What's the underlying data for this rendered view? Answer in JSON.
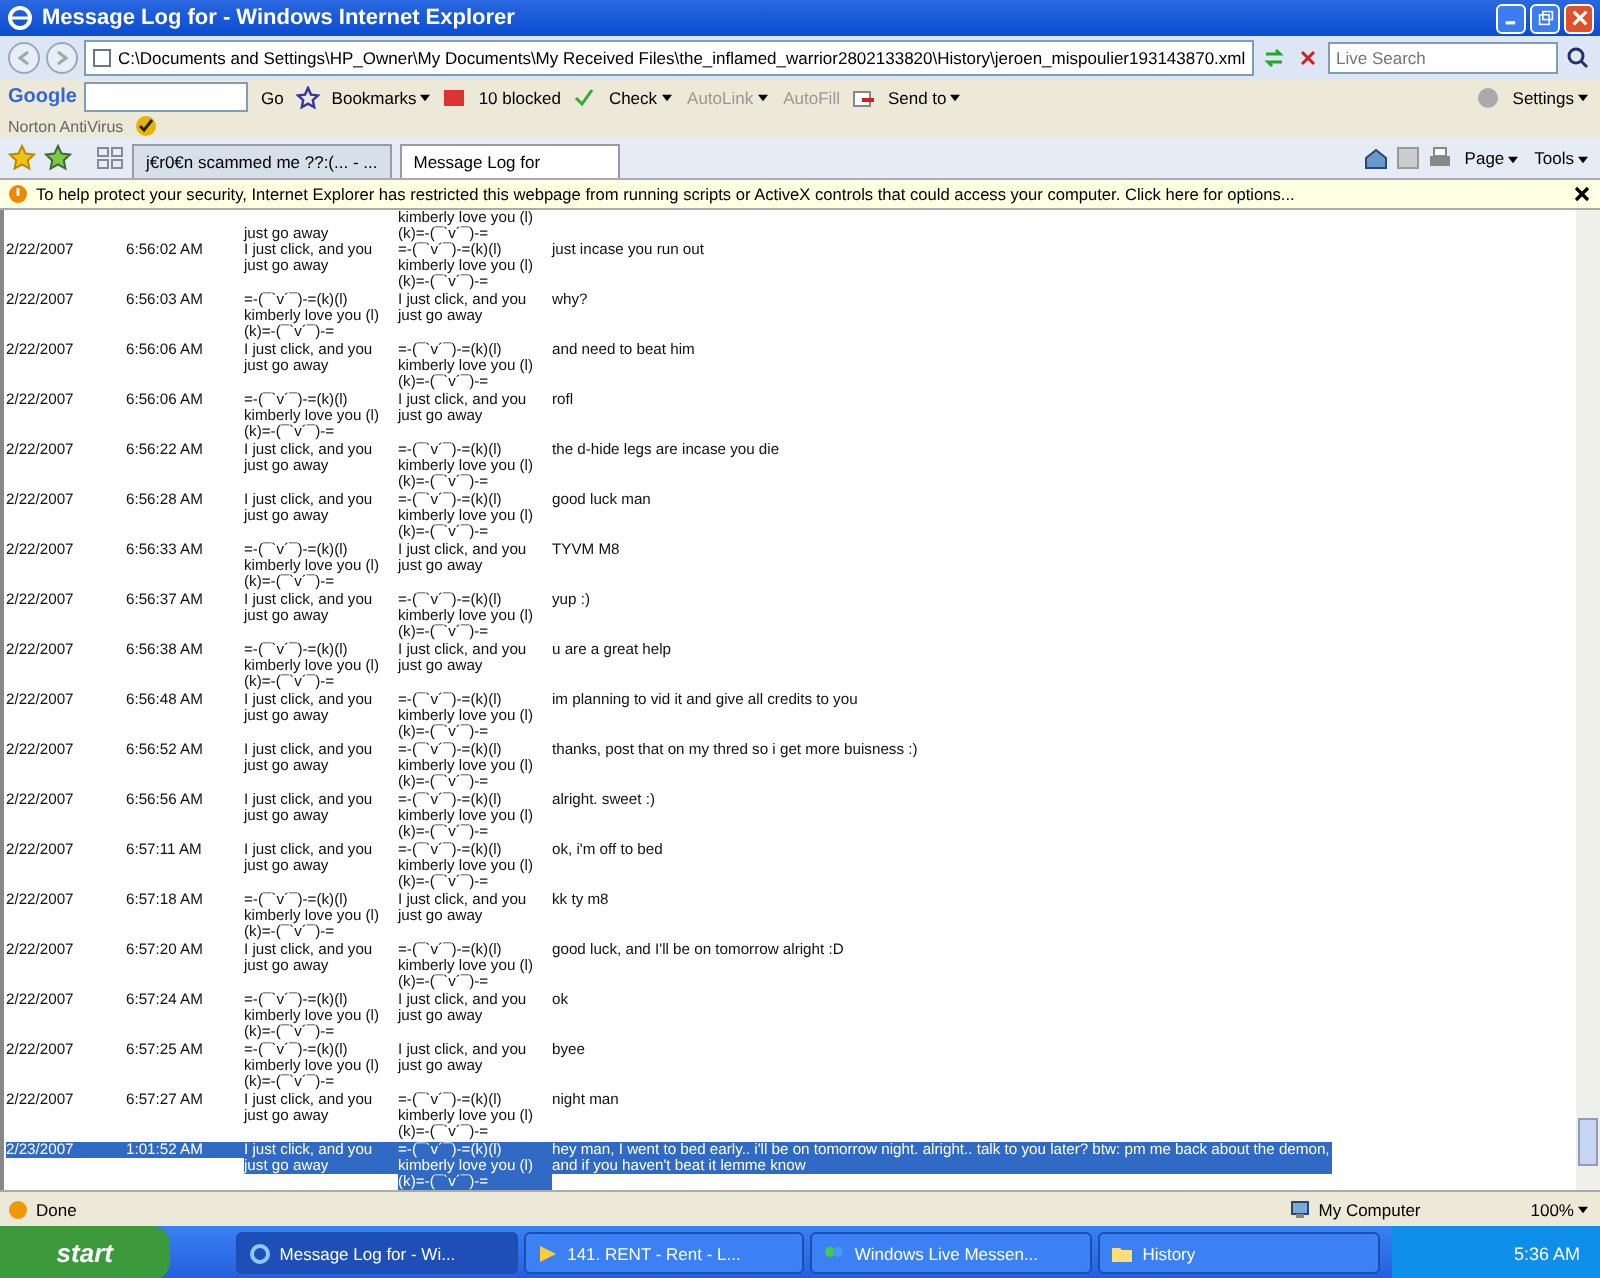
{
  "window": {
    "title": "Message Log for - Windows Internet Explorer"
  },
  "address": {
    "value": "C:\\Documents and Settings\\HP_Owner\\My Documents\\My Received Files\\the_inflamed_warrior2802133820\\History\\jeroen_mispoulier193143870.xml"
  },
  "search": {
    "placeholder": "Live Search"
  },
  "google_toolbar": {
    "logo": "Google",
    "go": "Go",
    "bookmarks": "Bookmarks",
    "blocked": "10 blocked",
    "check": "Check",
    "autolink": "AutoLink",
    "autofill": "AutoFill",
    "send_to": "Send to",
    "settings": "Settings"
  },
  "norton": {
    "label": "Norton AntiVirus"
  },
  "tabs": [
    {
      "label": "j€r0€n scammed me ??:(... - ...",
      "selected": false
    },
    {
      "label": "Message Log for",
      "selected": true
    }
  ],
  "command_bar": {
    "page": "Page",
    "tools": "Tools"
  },
  "info_bar": {
    "text": "To help protect your security, Internet Explorer has restricted this webpage from running scripts or ActiveX controls that could access your computer. Click here for options..."
  },
  "log_partial": {
    "from": "just go away",
    "to": "kimberly love you (l) (k)=-(¯`v´¯)-="
  },
  "log": [
    {
      "date": "2/22/2007",
      "time": "6:56:02 AM",
      "from": "I just click, and you just go away",
      "to": "=-(¯`v´¯)-=(k)(l) kimberly love you (l) (k)=-(¯`v´¯)-=",
      "message": "just incase you run out",
      "selected": false
    },
    {
      "date": "2/22/2007",
      "time": "6:56:03 AM",
      "from": "=-(¯`v´¯)-=(k)(l) kimberly love you (l) (k)=-(¯`v´¯)-=",
      "to": "I just click, and you just go away",
      "message": "why?",
      "selected": false
    },
    {
      "date": "2/22/2007",
      "time": "6:56:06 AM",
      "from": "I just click, and you just go away",
      "to": "=-(¯`v´¯)-=(k)(l) kimberly love you (l) (k)=-(¯`v´¯)-=",
      "message": "and need to beat him",
      "selected": false
    },
    {
      "date": "2/22/2007",
      "time": "6:56:06 AM",
      "from": "=-(¯`v´¯)-=(k)(l) kimberly love you (l) (k)=-(¯`v´¯)-=",
      "to": "I just click, and you just go away",
      "message": "rofl",
      "selected": false
    },
    {
      "date": "2/22/2007",
      "time": "6:56:22 AM",
      "from": "I just click, and you just go away",
      "to": "=-(¯`v´¯)-=(k)(l) kimberly love you (l) (k)=-(¯`v´¯)-=",
      "message": "the d-hide legs are incase you die",
      "selected": false
    },
    {
      "date": "2/22/2007",
      "time": "6:56:28 AM",
      "from": "I just click, and you just go away",
      "to": "=-(¯`v´¯)-=(k)(l) kimberly love you (l) (k)=-(¯`v´¯)-=",
      "message": "good luck man",
      "selected": false
    },
    {
      "date": "2/22/2007",
      "time": "6:56:33 AM",
      "from": "=-(¯`v´¯)-=(k)(l) kimberly love you (l) (k)=-(¯`v´¯)-=",
      "to": "I just click, and you just go away",
      "message": "TYVM M8",
      "selected": false
    },
    {
      "date": "2/22/2007",
      "time": "6:56:37 AM",
      "from": "I just click, and you just go away",
      "to": "=-(¯`v´¯)-=(k)(l) kimberly love you (l) (k)=-(¯`v´¯)-=",
      "message": "yup :)",
      "selected": false
    },
    {
      "date": "2/22/2007",
      "time": "6:56:38 AM",
      "from": "=-(¯`v´¯)-=(k)(l) kimberly love you (l) (k)=-(¯`v´¯)-=",
      "to": "I just click, and you just go away",
      "message": "u are a great help",
      "selected": false
    },
    {
      "date": "2/22/2007",
      "time": "6:56:48 AM",
      "from": "I just click, and you just go away",
      "to": "=-(¯`v´¯)-=(k)(l) kimberly love you (l) (k)=-(¯`v´¯)-=",
      "message": "im planning to vid it and give all credits to you",
      "selected": false
    },
    {
      "date": "2/22/2007",
      "time": "6:56:52 AM",
      "from": "I just click, and you just go away",
      "to": "=-(¯`v´¯)-=(k)(l) kimberly love you (l) (k)=-(¯`v´¯)-=",
      "message": "thanks, post that on my thred so i get more buisness :)",
      "selected": false
    },
    {
      "date": "2/22/2007",
      "time": "6:56:56 AM",
      "from": "I just click, and you just go away",
      "to": "=-(¯`v´¯)-=(k)(l) kimberly love you (l) (k)=-(¯`v´¯)-=",
      "message": "alright. sweet :)",
      "selected": false
    },
    {
      "date": "2/22/2007",
      "time": "6:57:11 AM",
      "from": "I just click, and you just go away",
      "to": "=-(¯`v´¯)-=(k)(l) kimberly love you (l) (k)=-(¯`v´¯)-=",
      "message": "ok, i'm off to bed",
      "selected": false
    },
    {
      "date": "2/22/2007",
      "time": "6:57:18 AM",
      "from": "=-(¯`v´¯)-=(k)(l) kimberly love you (l) (k)=-(¯`v´¯)-=",
      "to": "I just click, and you just go away",
      "message": "kk ty m8",
      "selected": false
    },
    {
      "date": "2/22/2007",
      "time": "6:57:20 AM",
      "from": "I just click, and you just go away",
      "to": "=-(¯`v´¯)-=(k)(l) kimberly love you (l) (k)=-(¯`v´¯)-=",
      "message": "good luck, and I'll be on tomorrow alright :D",
      "selected": false
    },
    {
      "date": "2/22/2007",
      "time": "6:57:24 AM",
      "from": "=-(¯`v´¯)-=(k)(l) kimberly love you (l) (k)=-(¯`v´¯)-=",
      "to": "I just click, and you just go away",
      "message": "ok",
      "selected": false
    },
    {
      "date": "2/22/2007",
      "time": "6:57:25 AM",
      "from": "=-(¯`v´¯)-=(k)(l) kimberly love you (l) (k)=-(¯`v´¯)-=",
      "to": "I just click, and you just go away",
      "message": "byee",
      "selected": false
    },
    {
      "date": "2/22/2007",
      "time": "6:57:27 AM",
      "from": "I just click, and you just go away",
      "to": "=-(¯`v´¯)-=(k)(l) kimberly love you (l) (k)=-(¯`v´¯)-=",
      "message": "night man",
      "selected": false
    },
    {
      "date": "2/23/2007",
      "time": "1:01:52 AM",
      "from": "I just click, and you just go away",
      "to": "=-(¯`v´¯)-=(k)(l) kimberly love you (l) (k)=-(¯`v´¯)-=",
      "message": "hey man, I went to bed early.. i'll be on tomorrow night. alright.. talk to you later? btw: pm me back about the demon, and if you haven't beat it lemme know",
      "selected": true
    }
  ],
  "status_bar": {
    "status": "Done",
    "zone": "My Computer",
    "zoom": "100%"
  },
  "taskbar": {
    "start": "start",
    "clock": "5:36 AM",
    "items": [
      {
        "label": "Message Log for - Wi...",
        "kind": "ie",
        "selected": true
      },
      {
        "label": "141. RENT - Rent - L...",
        "kind": "media",
        "selected": false
      },
      {
        "label": "Windows Live Messen...",
        "kind": "messenger",
        "selected": false
      },
      {
        "label": "History",
        "kind": "folder",
        "selected": false
      }
    ]
  }
}
